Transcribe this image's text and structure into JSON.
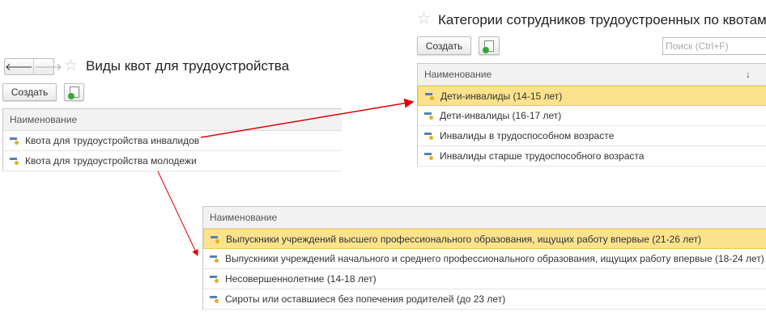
{
  "left": {
    "back": "🡐",
    "forward": "🡒",
    "title": "Виды квот для трудоустройства",
    "create": "Создать",
    "column": "Наименование",
    "rows": [
      "Квота для трудоустройства инвалидов",
      "Квота для трудоустройства молодежи"
    ]
  },
  "right": {
    "title": "Категории сотрудников трудоустроенных по квотам",
    "create": "Создать",
    "search_placeholder": "Поиск (Ctrl+F)",
    "column": "Наименование",
    "sort": "↓",
    "rows": [
      "Дети-инвалиды (14-15 лет)",
      "Дети-инвалиды (16-17 лет)",
      "Инвалиды в трудоспособном возрасте",
      "Инвалиды старше трудоспособного возраста"
    ]
  },
  "bottom": {
    "column": "Наименование",
    "rows": [
      "Выпускники учреждений высшего профессионального образования, ищущих работу впервые (21-26 лет)",
      "Выпускники учреждений начального и среднего профессионального образования, ищущих работу впервые (18-24 лет)",
      "Несовершеннолетние (14-18 лет)",
      "Сироты или оставшиеся без попечения родителей (до 23 лет)"
    ]
  },
  "colors": {
    "selected": "#fbe38e",
    "arrow": "#e00000"
  }
}
